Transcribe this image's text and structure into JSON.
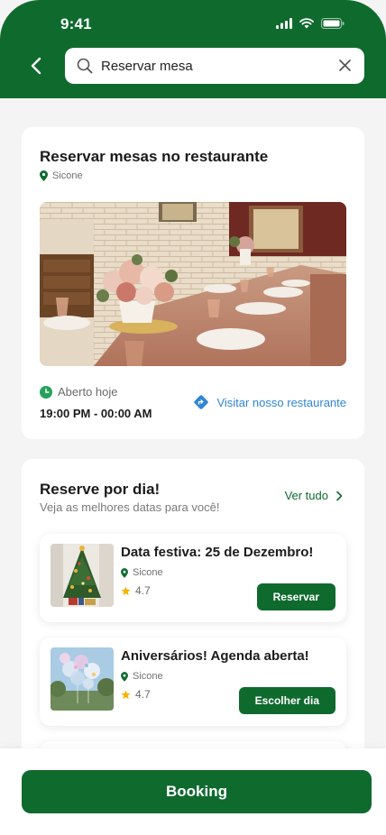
{
  "status_bar": {
    "time": "9:41"
  },
  "search": {
    "value": "Reservar mesa"
  },
  "restaurant_card": {
    "title": "Reservar mesas no restaurante",
    "location": "Sicone",
    "open_label": "Aberto hoje",
    "hours": "19:00 PM - 00:00 AM",
    "visit_link": "Visitar nosso restaurante"
  },
  "days_section": {
    "title": "Reserve por dia!",
    "subtitle": "Veja as melhores datas para você!",
    "see_all": "Ver tudo",
    "events": [
      {
        "title": "Data festiva: 25 de Dezembro!",
        "location": "Sicone",
        "rating": "4.7",
        "button": "Reservar"
      },
      {
        "title": "Aniversários! Agenda aberta!",
        "location": "Sicone",
        "rating": "4.7",
        "button": "Escolher dia"
      }
    ]
  },
  "bottom": {
    "booking_label": "Booking"
  },
  "colors": {
    "brand_green": "#0f6a2e",
    "link_blue": "#2f86d6",
    "star": "#f5b301"
  }
}
